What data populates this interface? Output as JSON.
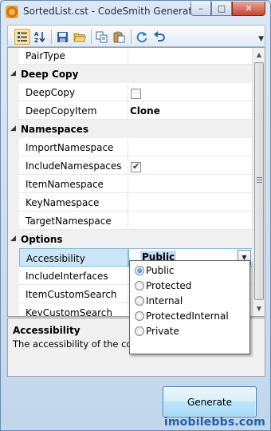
{
  "window": {
    "title": "SortedList.cst - CodeSmith Generator",
    "buttons": {
      "minimize": "–",
      "maximize": "□",
      "close": "✕"
    }
  },
  "toolbar": {
    "icons": [
      "categorized-icon",
      "alphabetical-sort-icon",
      "save-icon",
      "open-folder-icon",
      "copy-icon",
      "paste-icon",
      "refresh-icon",
      "undo-icon"
    ]
  },
  "grid": {
    "partial_row": {
      "name": "PairType",
      "value": ""
    },
    "categories": [
      {
        "label": "Deep Copy",
        "items": [
          {
            "name": "DeepCopy",
            "type": "checkbox",
            "checked": false
          },
          {
            "name": "DeepCopyItem",
            "type": "text",
            "value": "Clone"
          }
        ]
      },
      {
        "label": "Namespaces",
        "items": [
          {
            "name": "ImportNamespace",
            "type": "text",
            "value": ""
          },
          {
            "name": "IncludeNamespaces",
            "type": "checkbox",
            "checked": true
          },
          {
            "name": "ItemNamespace",
            "type": "text",
            "value": ""
          },
          {
            "name": "KeyNamespace",
            "type": "text",
            "value": ""
          },
          {
            "name": "TargetNamespace",
            "type": "text",
            "value": ""
          }
        ]
      },
      {
        "label": "Options",
        "items": [
          {
            "name": "Accessibility",
            "type": "dropdown",
            "value": "Public",
            "selected": true
          },
          {
            "name": "IncludeInterfaces",
            "type": "text",
            "value": ""
          },
          {
            "name": "ItemCustomSearch",
            "type": "text",
            "value": ""
          },
          {
            "name": "KeyCustomSearch",
            "type": "text",
            "value": ""
          }
        ]
      }
    ]
  },
  "dropdown": {
    "options": [
      "Public",
      "Protected",
      "Internal",
      "ProtectedInternal",
      "Private"
    ],
    "selected": "Public"
  },
  "description": {
    "title": "Accessibility",
    "text": "The accessibility of the colle"
  },
  "actions": {
    "generate_label": "Generate"
  },
  "watermark": "imobilebbs.com"
}
